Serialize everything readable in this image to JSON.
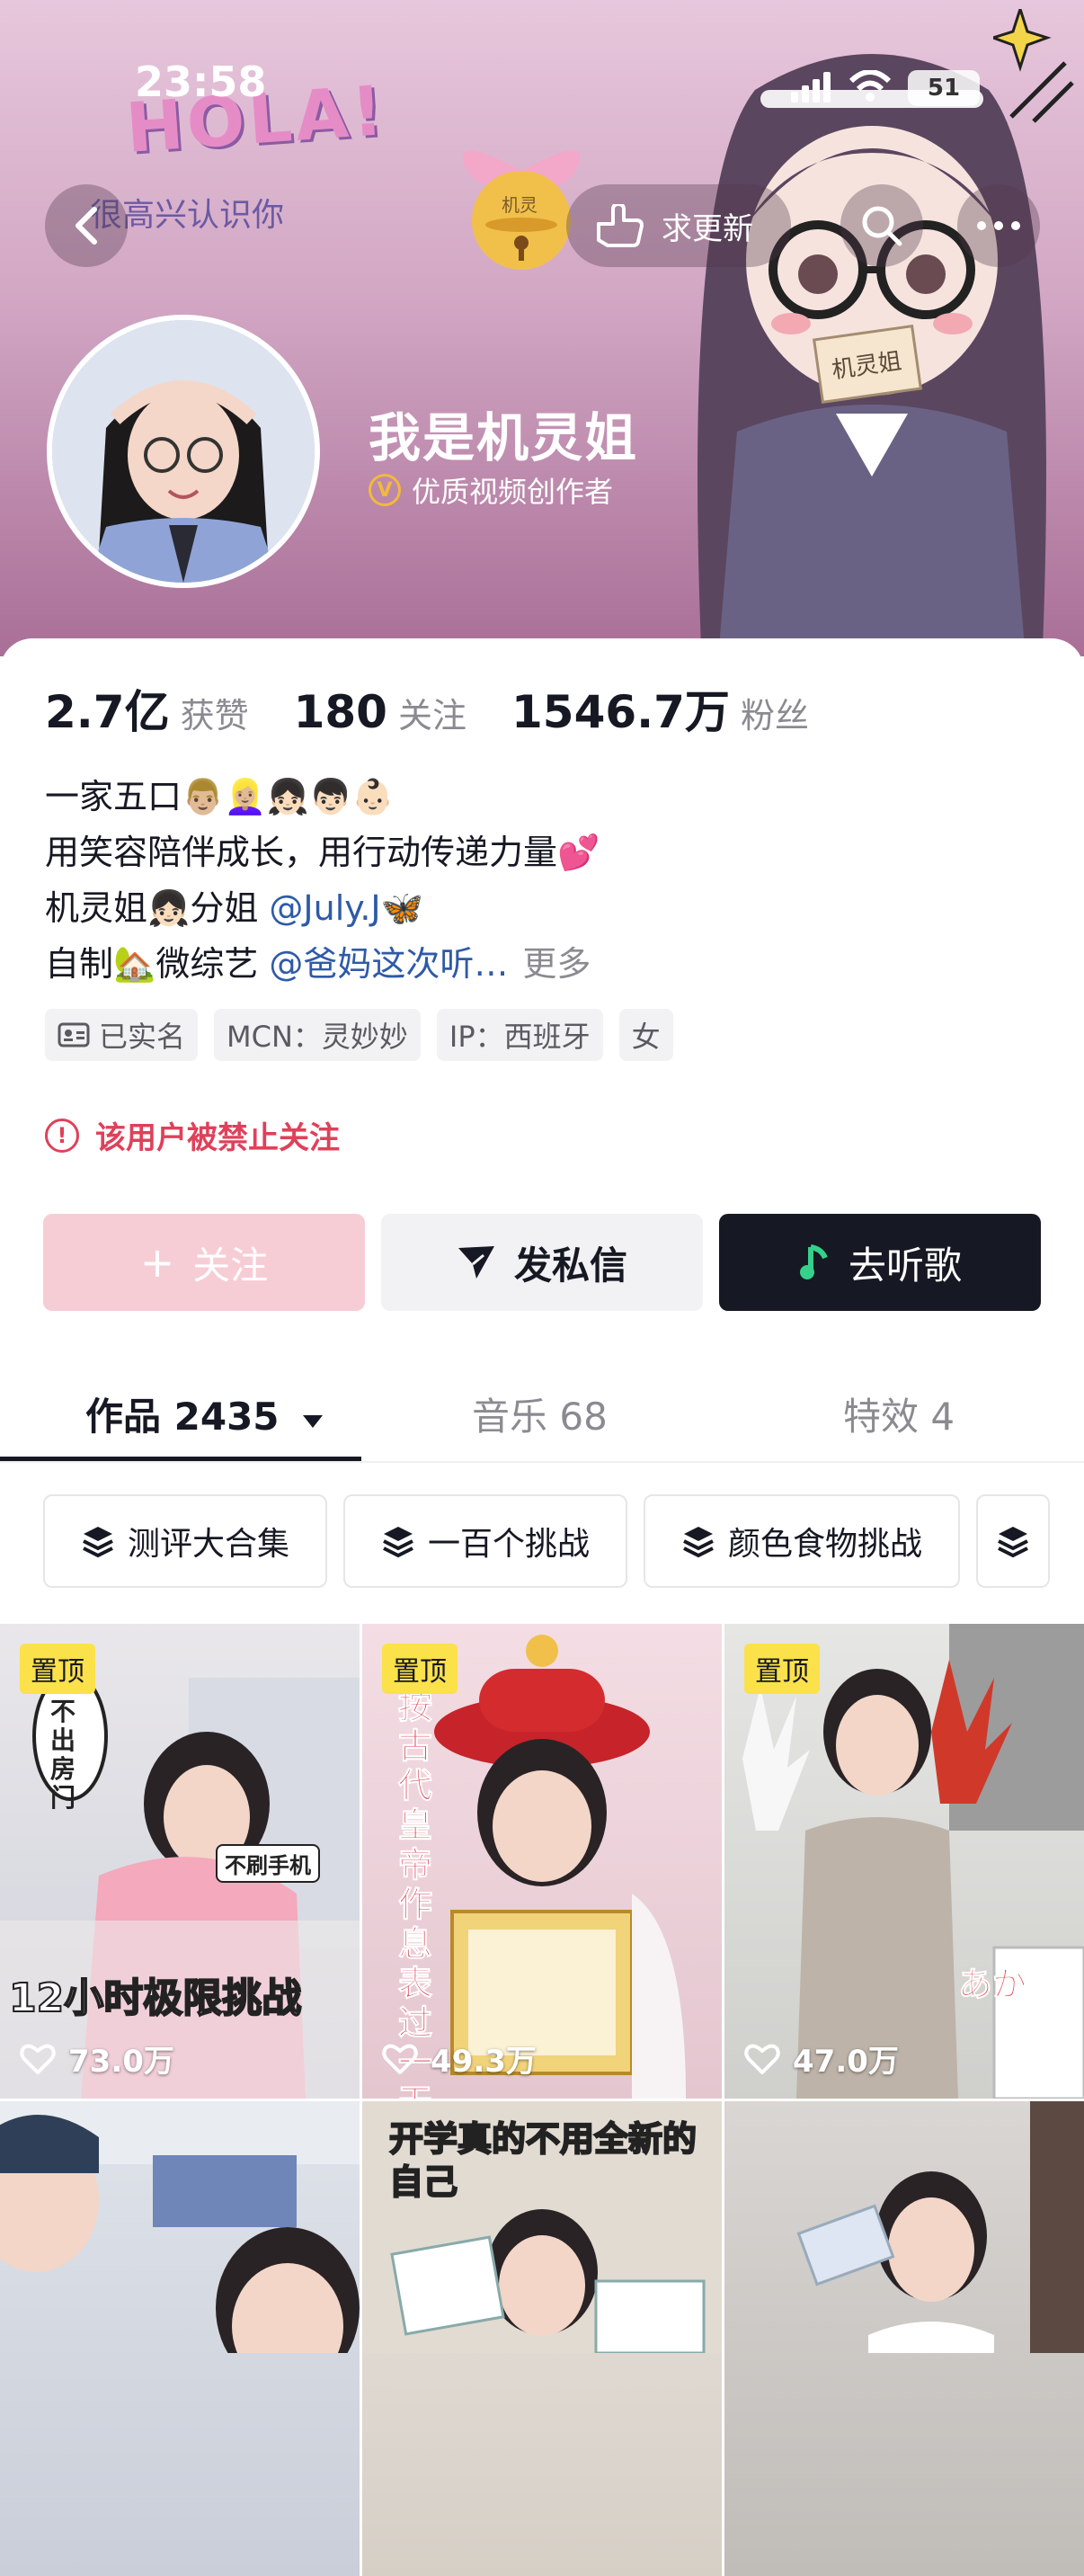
{
  "status_bar": {
    "time": "23:58",
    "battery": "51"
  },
  "banner": {
    "hola": "HOLA!",
    "greeting": "很高兴认识你",
    "bell_label": "机灵",
    "card_label": "机灵姐"
  },
  "header": {
    "request_update_label": "求更新"
  },
  "profile": {
    "name": "我是机灵姐",
    "badge": "优质视频创作者",
    "stats": [
      {
        "value": "2.7亿",
        "label": "获赞"
      },
      {
        "value": "180",
        "label": "关注"
      },
      {
        "value": "1546.7万",
        "label": "粉丝"
      }
    ],
    "bio": {
      "line1": "一家五口👨🏼👱🏼‍♀️👧🏻👦🏻👶🏻",
      "line2": "用笑容陪伴成长，用行动传递力量💕",
      "line3_prefix": "机灵姐👧🏻分姐 ",
      "line3_mention": "@July.J🦋",
      "line4_prefix": "自制🏡微综艺 ",
      "line4_mention": "@爸妈这次听…",
      "more": "更多"
    },
    "tags": [
      "已实名",
      "MCN：灵妙妙",
      "IP：西班牙",
      "女"
    ],
    "warning": "该用户被禁止关注"
  },
  "actions": {
    "follow": "关注",
    "message": "发私信",
    "music": "去听歌"
  },
  "tabs": [
    {
      "label": "作品 2435"
    },
    {
      "label": "音乐 68"
    },
    {
      "label": "特效 4"
    }
  ],
  "collections": [
    "测评大合集",
    "一百个挑战",
    "颜色食物挑战"
  ],
  "videos": [
    {
      "pinned": "置顶",
      "likes": "73.0万",
      "overlay": "12小时极限挑战",
      "bubble": "不出房门",
      "sticker": "不刷手机"
    },
    {
      "pinned": "置顶",
      "likes": "49.3万",
      "overlay": "按古代皇帝作息表过一天"
    },
    {
      "pinned": "置顶",
      "likes": "47.0万",
      "overlay": "あか"
    },
    {
      "overlay": ""
    },
    {
      "overlay": "开学真的不用全新的自己"
    },
    {
      "overlay": ""
    }
  ]
}
